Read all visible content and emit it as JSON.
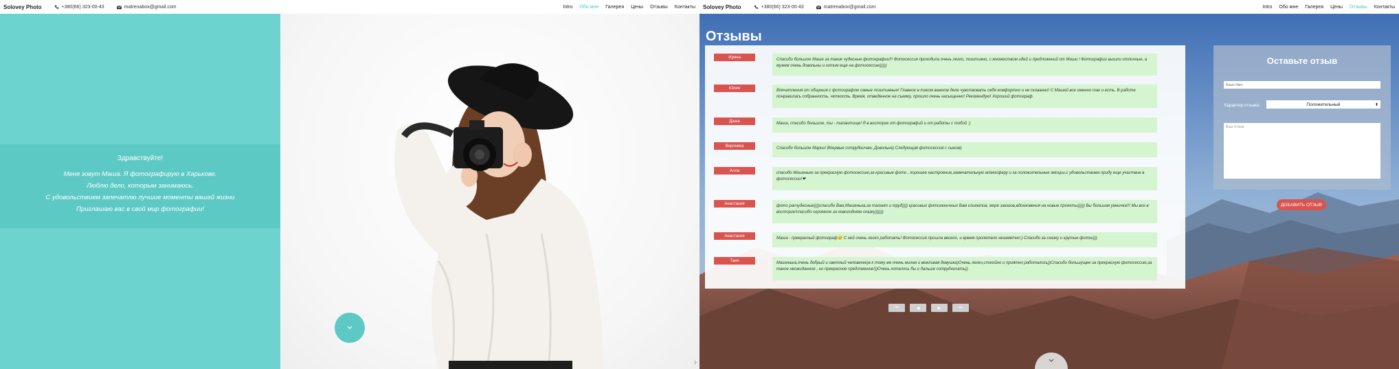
{
  "brand": "Solovey Photo",
  "phone": "+380(66) 323-00-43",
  "email": "matrenabox@gmail.com",
  "nav": [
    "Intro",
    "Обо мне",
    "Галерея",
    "Цены",
    "Отзывы",
    "Контакты"
  ],
  "left_active_nav": "Обо мне",
  "right_active_nav": "Отзывы",
  "about": {
    "greeting": "Здравствуйте!",
    "lines": [
      "Меня зовут Маша. Я фотографирую в Харькове.",
      "Люблю дело, которым занимаюсь.",
      "С удовольствием запечатлю лучшие моменты вашей жизни",
      "Приглашаю вас в свой мир фотографии!"
    ]
  },
  "reviews": {
    "title": "Отзывы",
    "items": [
      {
        "name": "Ирина",
        "text": "Спасибо большое Маше за такие чудесные фотографии!!! Фотосессия проходила очень легко, позитивно, с множеством идей и предложений от Маши ! Фотографии вышли отличные, а мужем очень довольны и хотим еще на фотосессию)))))"
      },
      {
        "name": "Юлия",
        "text": "Впечатления от общения с фотографом самые позитивные! Главное в таком важном деле чувствовать себя комфортно и не скованно! С Машей все именно так и есть. В работе понравилась собранность, четкость. Время, отведенное на съемку, прошло очень насыщенно! Рекомендую! Хороший фотограф."
      },
      {
        "name": "Даша",
        "text": "Маша, спасибо большое, ты - талантище! Я в восторге от фотографий и от работы с тобой :)"
      },
      {
        "name": "Вероника",
        "text": "Спасибо большое Марии! Впервые сотрудничаю. Довольна) Следующая фотосессия с сыном)"
      },
      {
        "name": "Алла",
        "text": "спасибо Машеньке за прекрасную фотосессию,за красивые фото , хорошее настроение,замечательную атмосферу и за положительные эмоции,с удовольствием приду еще участвие в фотосессии!❤"
      },
      {
        "name": "Анастасия",
        "text": "фото расчудесные))))спасибо Вам,Машенька,за талант и труд)))) красивых фотогеничных Вам клиентов, море заказов,вдохновения на новые проекты))))) Вы большая умничка!!! Мы все в восторге!спасибо огромное за новогоднюю сказку))))))"
      },
      {
        "name": "Анастасия",
        "text": "Маша - прекрасный фотограф😊 С ней очень легко работать! Фотосессия прошла весело, и время пролетело незаметно:) Спасибо за сказку и крутые фотки)))"
      },
      {
        "name": "Таня",
        "text": "Машенька,очень добрый и светлый человечек)в к тому же очень милая и вежливая девушка)Очень легко,спокойно и приятно работалось))Спасибо большущее за прекрасную фотосессию,за такое неожиданное , но прекрасное предложение!))Очень хотелось бы и дальше сотрудничать))"
      }
    ]
  },
  "pager": [
    "⏮",
    "◀",
    "▶",
    "⏭"
  ],
  "form": {
    "title": "Оставьте отзыв",
    "name_placeholder": "Ваше Имя",
    "type_label": "Характер отзыва:",
    "type_value": "Положительный",
    "text_placeholder": "Ваш Отзыв",
    "submit": "ДОБАВИТЬ ОТЗЫВ"
  },
  "colors": {
    "teal": "#6dd3cf",
    "accent_red": "#d9534f",
    "review_green": "#d4f5d0"
  }
}
